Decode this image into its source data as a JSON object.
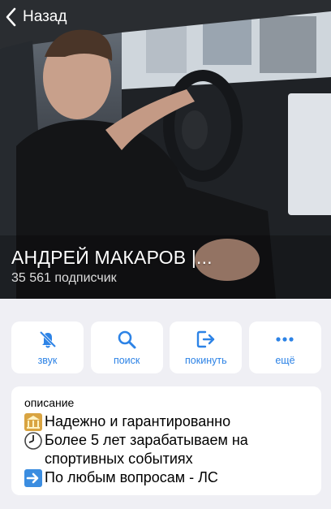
{
  "nav": {
    "back_label": "Назад"
  },
  "channel": {
    "name": "АНДРЕЙ МАКАРОВ |...",
    "subscribers": "35 561 подписчик"
  },
  "actions": [
    {
      "label": "звук",
      "icon": "bell-slash-icon"
    },
    {
      "label": "поиск",
      "icon": "search-icon"
    },
    {
      "label": "покинуть",
      "icon": "leave-icon"
    },
    {
      "label": "ещё",
      "icon": "more-icon"
    }
  ],
  "description": {
    "heading": "описание",
    "lines": [
      {
        "icon": "bank-icon",
        "text": "Надежно и гарантированно"
      },
      {
        "icon": "clock-icon",
        "text": "Более 5 лет зарабатываем на спортивных событиях"
      },
      {
        "icon": "right-arrow-icon",
        "text": "По любым вопросам - ЛС"
      }
    ]
  },
  "colors": {
    "accent": "#2d83e6",
    "background": "#efeff4",
    "card": "#ffffff"
  }
}
